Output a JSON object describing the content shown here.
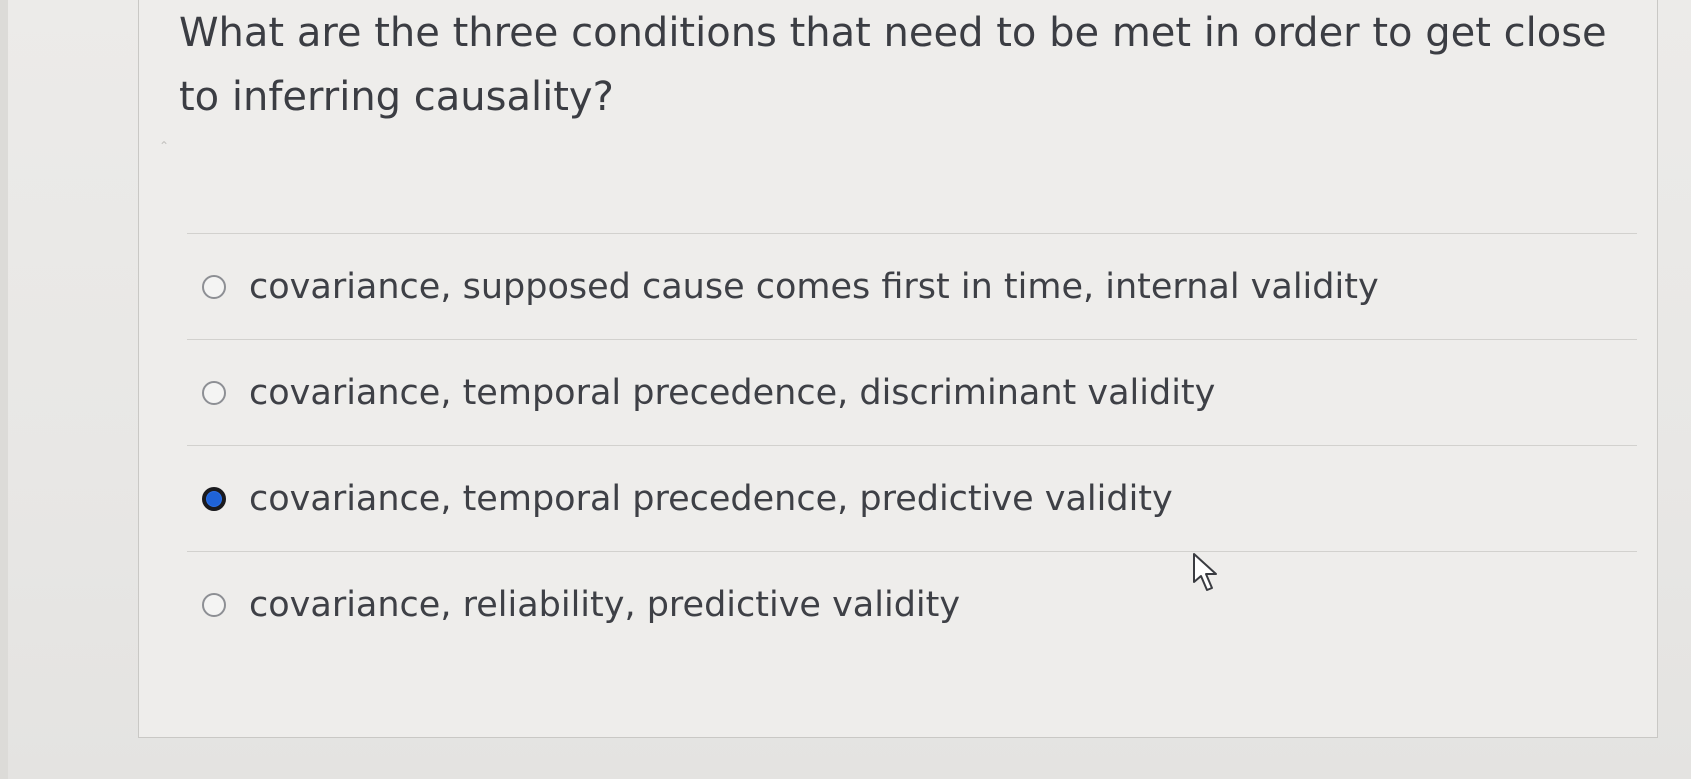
{
  "question": {
    "text": "What are the three conditions that need to be met in order to get close to inferring causality?"
  },
  "options": [
    {
      "label": "covariance, supposed cause comes first in time, internal validity",
      "selected": false
    },
    {
      "label": "covariance, temporal precedence, discriminant validity",
      "selected": false
    },
    {
      "label": "covariance, temporal precedence, predictive validity",
      "selected": true
    },
    {
      "label": "covariance, reliability, predictive validity",
      "selected": false
    }
  ],
  "colors": {
    "selected_radio": "#1f63d8",
    "text": "#3e4046",
    "background": "#eeedeb"
  },
  "icons": {
    "cursor": "mouse-pointer-icon"
  }
}
